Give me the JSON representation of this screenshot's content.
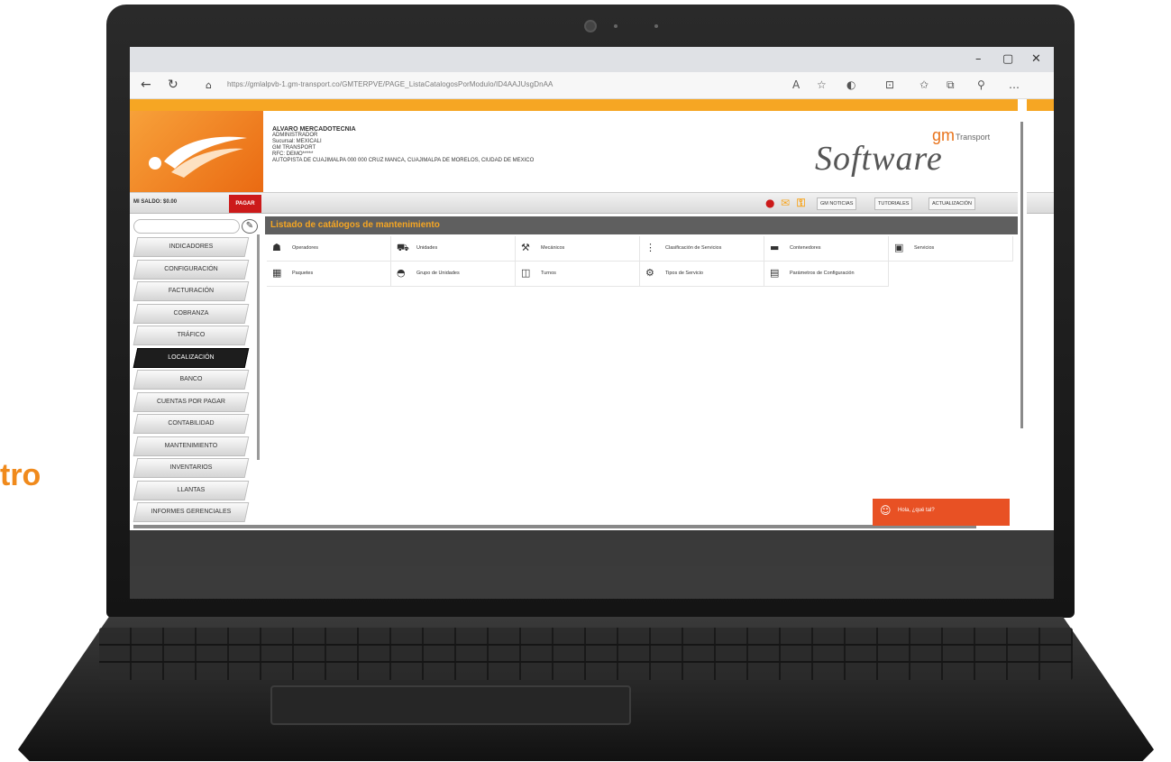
{
  "side_text": "tro",
  "browser": {
    "window_controls": [
      "–",
      "▢",
      "✕"
    ],
    "url": "https://gmlalpvb-1.gm-transport.co/GMTERPVE/PAGE_ListaCatalogosPorModulo/ID4AAJUsgDnAA",
    "toolbar_icons": [
      "A",
      "☆",
      "◐",
      "⊡",
      "✩",
      "⧉",
      "⚲",
      "…"
    ]
  },
  "header": {
    "user_name": "ALVARO MERCADOTECNIA",
    "user_role": "ADMINISTRADOR",
    "sucursal": "Sucursal: MEXICALI",
    "company": "GM TRANSPORT",
    "rfc": "RFC: DEMO*****",
    "address": "AUTOPISTA DE CUAJIMALPA 000 000 CRUZ MANCA, CUAJIMALPA DE MORELOS, CIUDAD DE MEXICO",
    "brand_gm": "gm",
    "brand_transport": "Transport",
    "brand_software": "Software"
  },
  "bar": {
    "saldo_label": "MI SALDO:",
    "saldo_value": "$0.00",
    "pagar": "PAGAR",
    "buttons": [
      "GM NOTICIAS",
      "TUTORIALES",
      "ACTUALIZACIÓN"
    ]
  },
  "sidebar": {
    "items": [
      "INDICADORES",
      "CONFIGURACIÓN",
      "FACTURACIÓN",
      "COBRANZA",
      "TRÁFICO",
      "LOCALIZACIÓN",
      "BANCO",
      "CUENTAS POR PAGAR",
      "CONTABILIDAD",
      "MANTENIMIENTO",
      "INVENTARIOS",
      "LLANTAS",
      "INFORMES GERENCIALES"
    ],
    "active": "LOCALIZACIÓN"
  },
  "content": {
    "title": "Listado de catálogos de mantenimiento",
    "items": [
      {
        "icon": "operator-icon",
        "label": "Operadores"
      },
      {
        "icon": "truck-icon",
        "label": "Unidades"
      },
      {
        "icon": "mechanic-icon",
        "label": "Mecánicos"
      },
      {
        "icon": "classification-icon",
        "label": "Clasificación de Servicios"
      },
      {
        "icon": "containers-icon",
        "label": "Contenedores"
      },
      {
        "icon": "services-icon",
        "label": "Servicios"
      },
      {
        "icon": "packages-icon",
        "label": "Paquetes"
      },
      {
        "icon": "unit-groups-icon",
        "label": "Grupo de Unidades"
      },
      {
        "icon": "shifts-icon",
        "label": "Turnos"
      },
      {
        "icon": "service-types-icon",
        "label": "Tipos de Servicio"
      },
      {
        "icon": "config-params-icon",
        "label": "Parámetros de Configuración"
      }
    ]
  },
  "chat": {
    "text": "Hola, ¿qué tal?"
  }
}
